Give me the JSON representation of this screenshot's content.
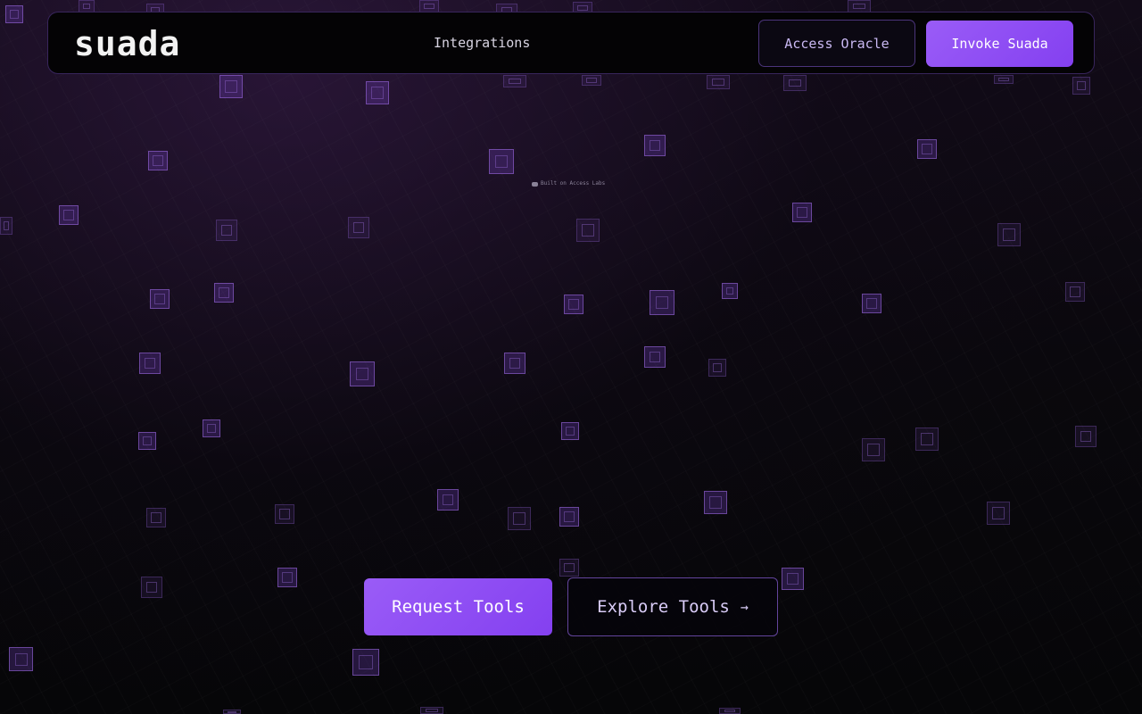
{
  "header": {
    "logo": "suada",
    "nav": {
      "integrations": "Integrations"
    },
    "access_oracle_label": "Access Oracle",
    "invoke_label": "Invoke Suada"
  },
  "hero": {
    "badge_text": "Built on Access Labs",
    "request_tools_label": "Request Tools",
    "explore_tools_label": "Explore Tools",
    "explore_icon": "arrow-right-icon"
  },
  "colors": {
    "accent": "#8a4af3",
    "background": "#060508",
    "text": "#f2f2f2"
  }
}
